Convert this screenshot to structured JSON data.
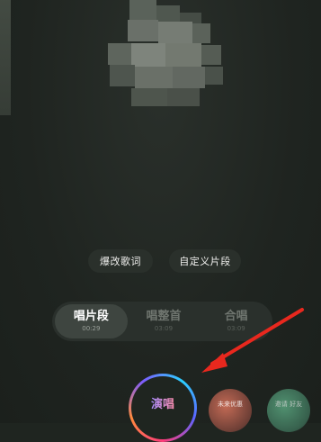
{
  "actions": {
    "edit_lyrics": "爆改歌词",
    "custom_segment": "自定义片段"
  },
  "mode_tabs": [
    {
      "label": "唱片段",
      "duration": "00:29",
      "selected": true
    },
    {
      "label": "唱整首",
      "duration": "03:09",
      "selected": false
    },
    {
      "label": "合唱",
      "duration": "03:09",
      "selected": false
    }
  ],
  "bottom": {
    "sing_label": "演唱",
    "left_circle_label": "未来优惠",
    "right_circle_label": "邀请 好友"
  },
  "colors": {
    "background": "#1f2520",
    "annotation_arrow": "#e8281e"
  }
}
